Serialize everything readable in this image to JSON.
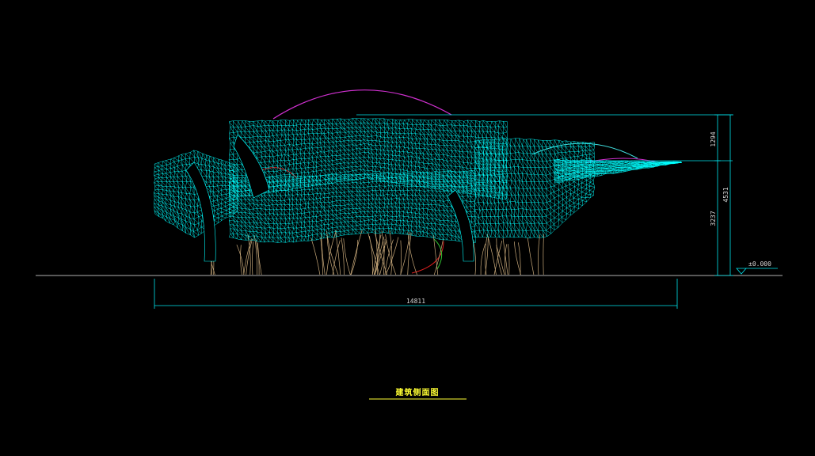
{
  "drawing": {
    "title": "建筑侧面图",
    "dimensions": {
      "overall_width": "14811",
      "overall_height": "4531",
      "upper_segment": "1294",
      "lower_segment": "3237",
      "level_marker": "±0.000"
    },
    "colors": {
      "background": "#000000",
      "mesh": "#00ffff",
      "columns": "#c8a97a",
      "dimension": "#00e5ee",
      "ground": "#c0c0c0",
      "arc_top": "#d030d0",
      "arc_red": "#e02020",
      "arc_green": "#30c030",
      "title": "#ffff33"
    }
  }
}
